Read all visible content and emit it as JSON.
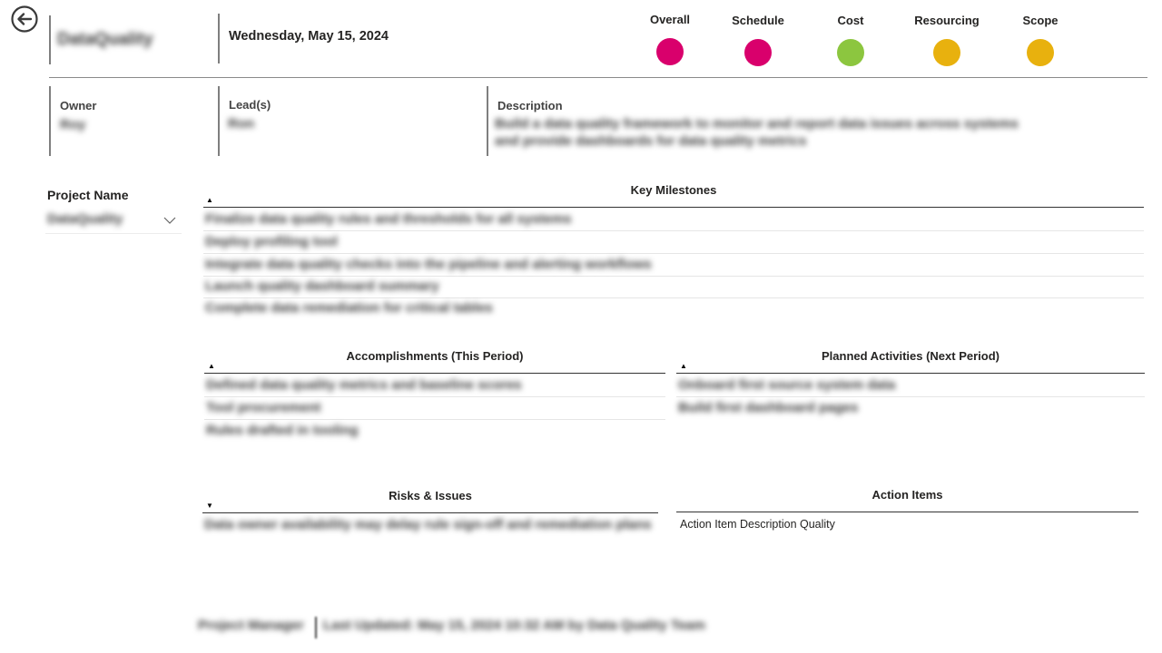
{
  "header": {
    "project_title": "DataQuality",
    "date": "Wednesday, May 15, 2024",
    "statuses": [
      {
        "label": "Overall",
        "color": "#d9006c"
      },
      {
        "label": "Schedule",
        "color": "#d9006c"
      },
      {
        "label": "Cost",
        "color": "#8cc63f"
      },
      {
        "label": "Resourcing",
        "color": "#e8b10e"
      },
      {
        "label": "Scope",
        "color": "#e8b10e"
      }
    ]
  },
  "info": {
    "owner_label": "Owner",
    "owner_value": "Roy",
    "leads_label": "Lead(s)",
    "leads_value": "Ron",
    "description_label": "Description",
    "description_line1": "Build a data quality framework to monitor and report data issues across systems",
    "description_line2": "and provide dashboards for data quality metrics"
  },
  "filter": {
    "label": "Project Name",
    "selected": "DataQuality"
  },
  "milestones": {
    "title": "Key Milestones",
    "rows": [
      "Finalize data quality rules and thresholds for all systems",
      "Deploy profiling tool",
      "Integrate data quality checks into the pipeline and alerting workflows",
      "Launch quality dashboard summary",
      "Complete data remediation for critical tables"
    ]
  },
  "accomplishments": {
    "title": "Accomplishments (This Period)",
    "rows": [
      "Defined data quality metrics and baseline scores",
      "Tool procurement",
      "Rules drafted in tooling"
    ]
  },
  "planned": {
    "title": "Planned Activities (Next Period)",
    "rows": [
      "Onboard first source system data",
      "Build first dashboard pages"
    ]
  },
  "risks": {
    "title": "Risks & Issues",
    "rows": [
      "Data owner availability may delay rule sign-off and remediation plans"
    ]
  },
  "actions": {
    "title": "Action Items",
    "rows": [
      "Action Item Description Quality"
    ]
  },
  "footer": {
    "left": "Project Manager",
    "right": "Last Updated: May 15, 2024 10:32 AM by Data Quality Team"
  }
}
